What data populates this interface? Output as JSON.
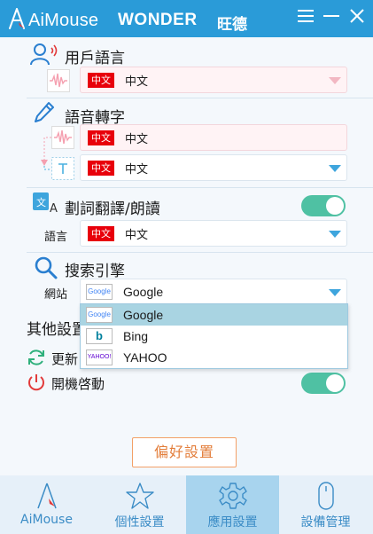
{
  "header": {
    "app_name": "AiMouse",
    "brand": "WONDER",
    "brand_cn": "旺德"
  },
  "sections": {
    "user_language": {
      "title": "用戶語言",
      "flag": "中文",
      "value": "中文"
    },
    "speech_to_text": {
      "title": "語音轉字",
      "from_flag": "中文",
      "from_value": "中文",
      "to_flag": "中文",
      "to_value": "中文"
    },
    "translate": {
      "title": "劃詞翻譯/朗讀",
      "toggle_on": true,
      "lang_label": "語言",
      "flag": "中文",
      "value": "中文"
    },
    "search": {
      "title": "搜索引擎",
      "site_label": "網站",
      "selected": "Google",
      "options": [
        {
          "label": "Google",
          "icon": "Google"
        },
        {
          "label": "Bing",
          "icon": "b"
        },
        {
          "label": "YAHOO",
          "icon": "YAHOO!"
        }
      ]
    },
    "other": {
      "title": "其他設置",
      "update_label": "更新",
      "startup_label": "開機啓動",
      "startup_on": true
    }
  },
  "preferences_button": "偏好設置",
  "tabs": [
    {
      "label": "AiMouse",
      "icon": "aimouse-icon"
    },
    {
      "label": "個性設置",
      "icon": "star-icon"
    },
    {
      "label": "應用設置",
      "icon": "gear-icon",
      "active": true
    },
    {
      "label": "設備管理",
      "icon": "mouse-icon"
    }
  ],
  "colors": {
    "header": "#2a9bd8",
    "accent": "#3ea5dd",
    "toggle": "#4fc1a3",
    "flag_red": "#e8000b",
    "pref_orange": "#e37d3a",
    "tab_active": "#a8d4ee"
  }
}
